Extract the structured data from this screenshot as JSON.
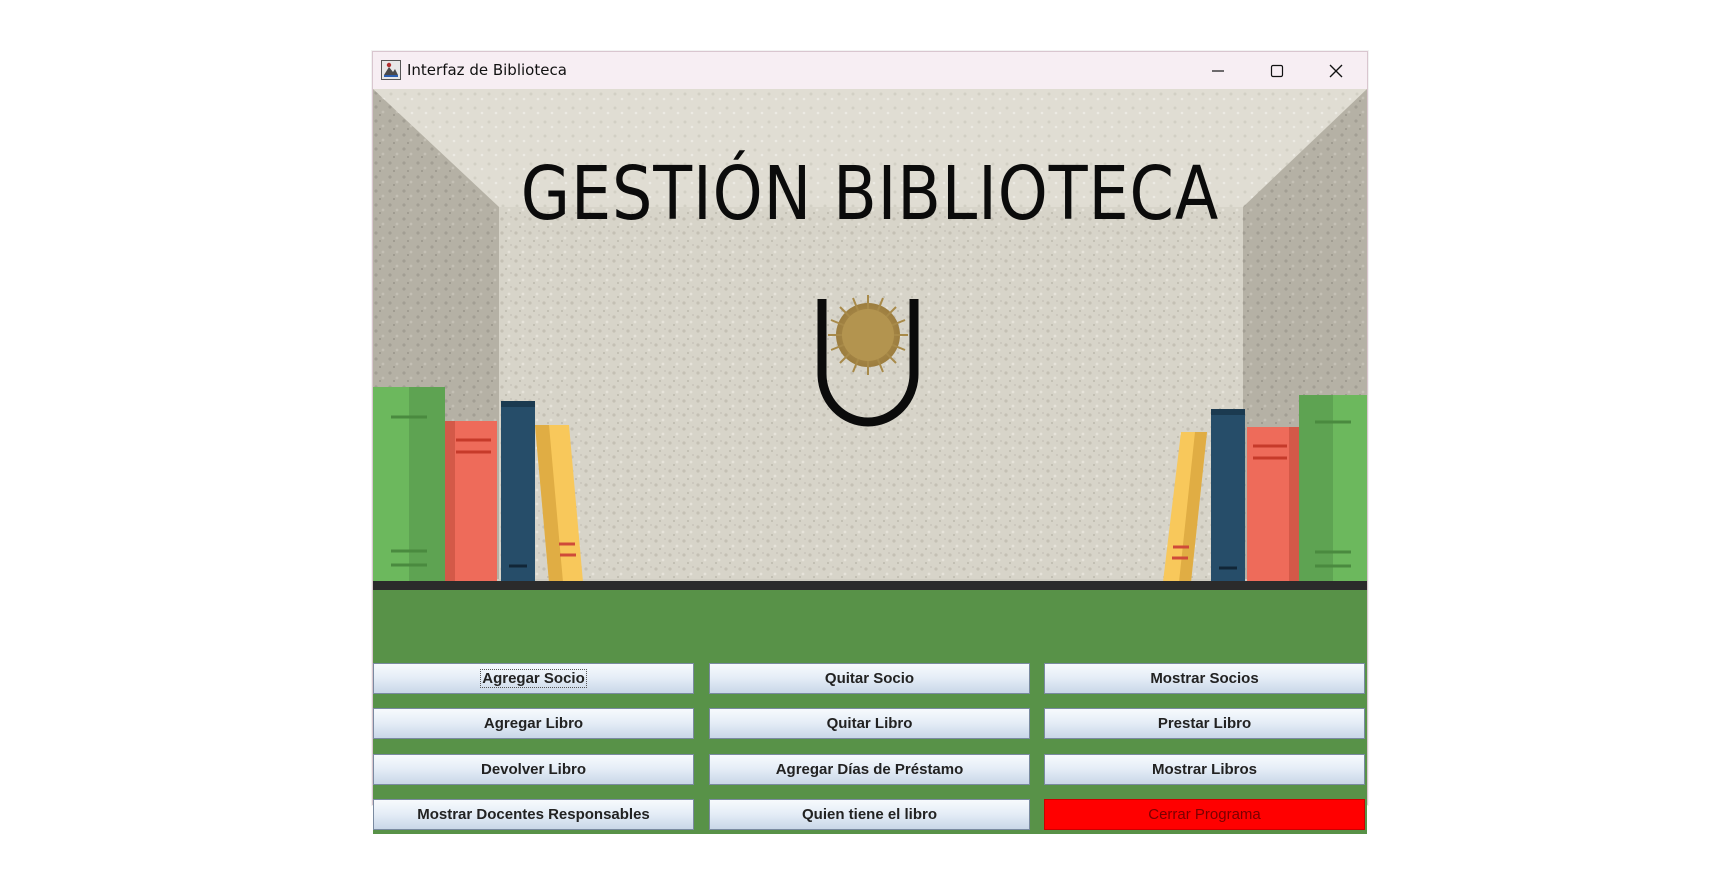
{
  "window": {
    "title": "Interfaz de Biblioteca"
  },
  "banner": {
    "heading": "GESTIÓN BIBLIOTECA",
    "logo": "sun-shield-logo"
  },
  "buttons": [
    {
      "label": "Agregar Socio",
      "focused": true
    },
    {
      "label": "Quitar Socio"
    },
    {
      "label": "Mostrar Socios"
    },
    {
      "label": "Agregar Libro"
    },
    {
      "label": "Quitar Libro"
    },
    {
      "label": "Prestar Libro"
    },
    {
      "label": "Devolver Libro"
    },
    {
      "label": "Agregar Días de Préstamo"
    },
    {
      "label": "Mostrar Libros"
    },
    {
      "label": "Mostrar Docentes Responsables"
    },
    {
      "label": "Quien tiene el libro"
    },
    {
      "label": "Cerrar Programa",
      "variant": "danger"
    }
  ],
  "colors": {
    "panel_green": "#589248",
    "close_program_red": "#ff0000",
    "titlebar": "#f7eef3"
  },
  "icons": {
    "app": "java-app-icon",
    "minimize": "minimize-icon",
    "maximize": "maximize-icon",
    "close": "close-icon"
  }
}
